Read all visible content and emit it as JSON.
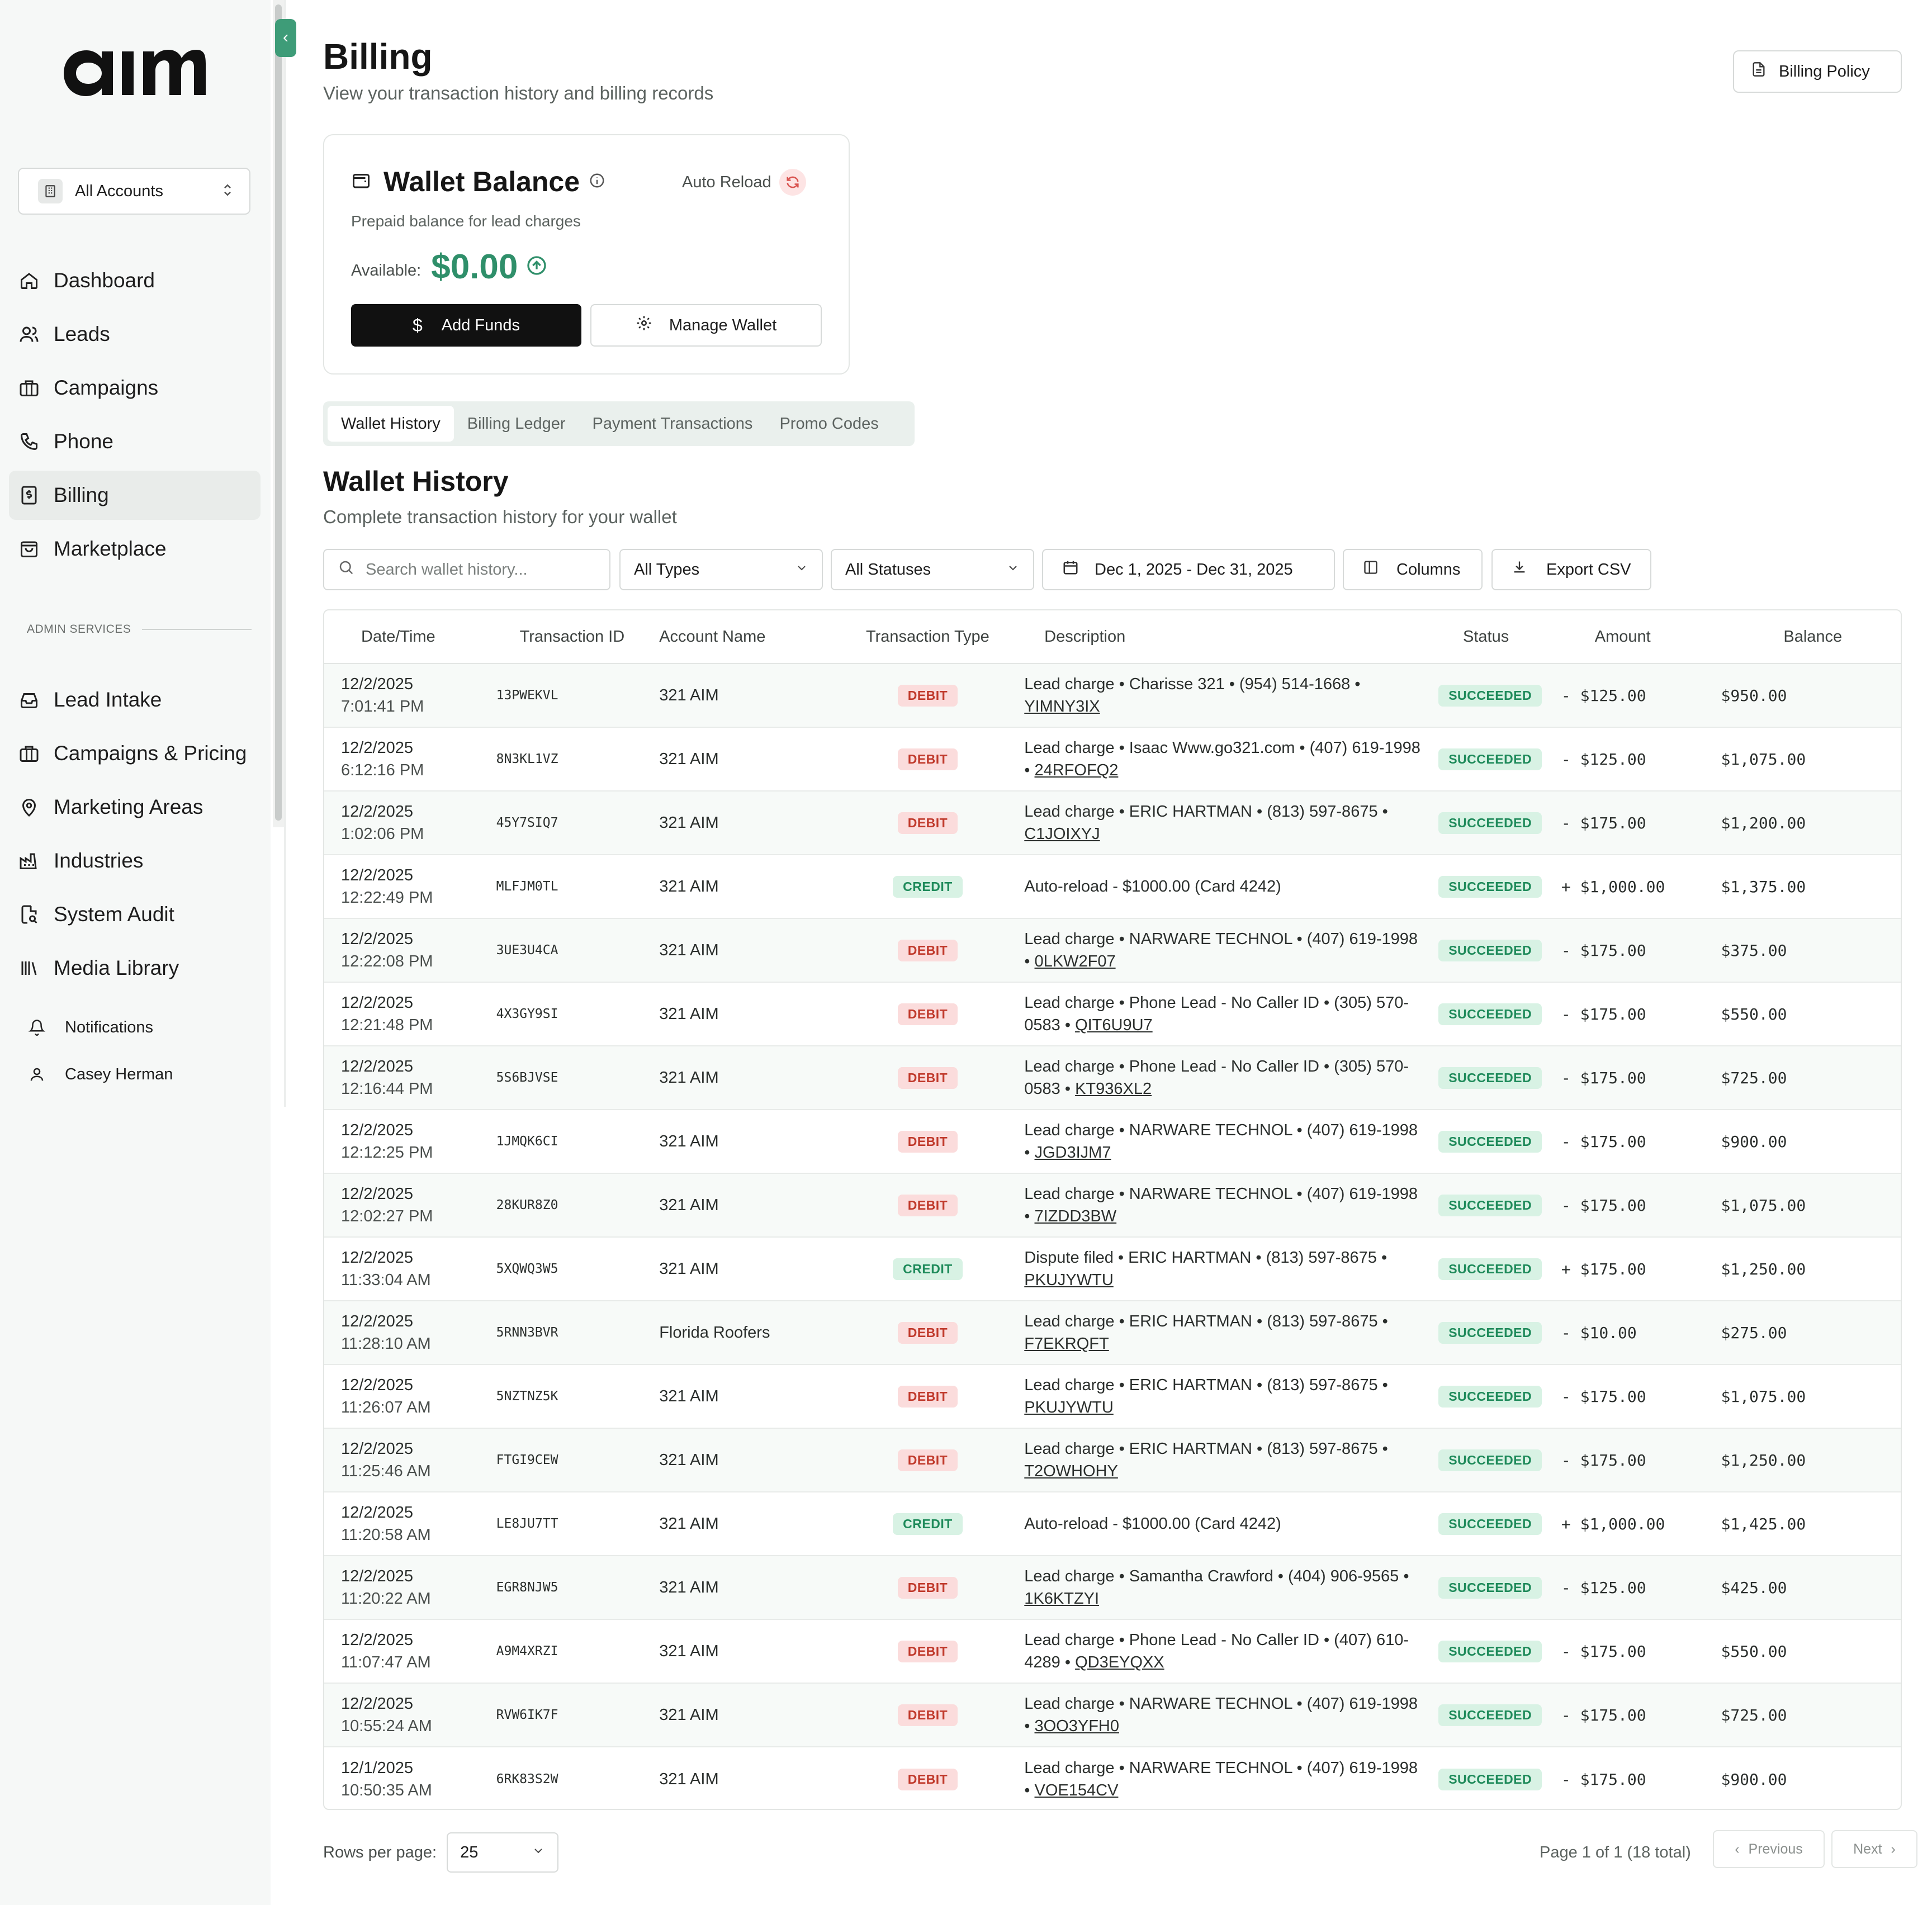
{
  "app": {
    "logo_text": "aim"
  },
  "sidebar": {
    "account_switcher": "All Accounts",
    "nav": [
      {
        "label": "Dashboard",
        "icon": "home-icon",
        "active": false
      },
      {
        "label": "Leads",
        "icon": "users-icon",
        "active": false
      },
      {
        "label": "Campaigns",
        "icon": "briefcase-icon",
        "active": false
      },
      {
        "label": "Phone",
        "icon": "phone-icon",
        "active": false
      },
      {
        "label": "Billing",
        "icon": "receipt-icon",
        "active": true
      },
      {
        "label": "Marketplace",
        "icon": "shopping-bag-icon",
        "active": false
      }
    ],
    "admin_label": "ADMIN SERVICES",
    "admin_nav": [
      {
        "label": "Lead Intake",
        "icon": "inbox-icon"
      },
      {
        "label": "Campaigns & Pricing",
        "icon": "briefcase-icon"
      },
      {
        "label": "Marketing Areas",
        "icon": "map-pin-icon"
      },
      {
        "label": "Industries",
        "icon": "factory-icon"
      },
      {
        "label": "System Audit",
        "icon": "file-search-icon"
      },
      {
        "label": "Media Library",
        "icon": "library-icon"
      }
    ],
    "notifications": "Notifications",
    "user": "Casey Herman"
  },
  "header": {
    "title": "Billing",
    "subtitle": "View your transaction history and billing records",
    "policy_button": "Billing Policy"
  },
  "wallet": {
    "title": "Wallet Balance",
    "auto_reload": "Auto Reload",
    "description": "Prepaid balance for lead charges",
    "available_label": "Available:",
    "available_value": "$0.00",
    "add_funds": "Add Funds",
    "manage_wallet": "Manage Wallet"
  },
  "tabs": [
    "Wallet History",
    "Billing Ledger",
    "Payment Transactions",
    "Promo Codes"
  ],
  "section": {
    "title": "Wallet History",
    "subtitle": "Complete transaction history for your wallet"
  },
  "filters": {
    "search_placeholder": "Search wallet history...",
    "type": "All Types",
    "status": "All Statuses",
    "date_range": "Dec 1, 2025 - Dec 31, 2025",
    "columns": "Columns",
    "export": "Export CSV"
  },
  "table": {
    "headers": [
      "Date/Time",
      "Transaction ID",
      "Account Name",
      "Transaction Type",
      "Description",
      "Status",
      "Amount",
      "Balance"
    ],
    "rows": [
      {
        "date": "12/2/2025",
        "time": "7:01:41 PM",
        "id": "13PWEKVL",
        "account": "321 AIM",
        "type": "DEBIT",
        "desc": "Lead charge • Charisse 321 • (954) 514-1668 • ",
        "ref": "YIMNY3IX",
        "status": "SUCCEEDED",
        "amount": "- $125.00",
        "balance": "$950.00"
      },
      {
        "date": "12/2/2025",
        "time": "6:12:16 PM",
        "id": "8N3KL1VZ",
        "account": "321 AIM",
        "type": "DEBIT",
        "desc": "Lead charge • Isaac Www.go321.com • (407) 619-1998 • ",
        "ref": "24RFOFQ2",
        "status": "SUCCEEDED",
        "amount": "- $125.00",
        "balance": "$1,075.00"
      },
      {
        "date": "12/2/2025",
        "time": "1:02:06 PM",
        "id": "45Y7SIQ7",
        "account": "321 AIM",
        "type": "DEBIT",
        "desc": "Lead charge • ERIC HARTMAN • (813) 597-8675 • ",
        "ref": "C1JOIXYJ",
        "status": "SUCCEEDED",
        "amount": "- $175.00",
        "balance": "$1,200.00"
      },
      {
        "date": "12/2/2025",
        "time": "12:22:49 PM",
        "id": "MLFJM0TL",
        "account": "321 AIM",
        "type": "CREDIT",
        "desc": "Auto-reload - $1000.00 (Card 4242)",
        "ref": "",
        "status": "SUCCEEDED",
        "amount": "+ $1,000.00",
        "balance": "$1,375.00"
      },
      {
        "date": "12/2/2025",
        "time": "12:22:08 PM",
        "id": "3UE3U4CA",
        "account": "321 AIM",
        "type": "DEBIT",
        "desc": "Lead charge • NARWARE TECHNOL • (407) 619-1998 • ",
        "ref": "0LKW2F07",
        "status": "SUCCEEDED",
        "amount": "- $175.00",
        "balance": "$375.00"
      },
      {
        "date": "12/2/2025",
        "time": "12:21:48 PM",
        "id": "4X3GY9SI",
        "account": "321 AIM",
        "type": "DEBIT",
        "desc": "Lead charge • Phone Lead - No Caller ID • (305) 570-0583 • ",
        "ref": "QIT6U9U7",
        "status": "SUCCEEDED",
        "amount": "- $175.00",
        "balance": "$550.00"
      },
      {
        "date": "12/2/2025",
        "time": "12:16:44 PM",
        "id": "5S6BJVSE",
        "account": "321 AIM",
        "type": "DEBIT",
        "desc": "Lead charge • Phone Lead - No Caller ID • (305) 570-0583 • ",
        "ref": "KT936XL2",
        "status": "SUCCEEDED",
        "amount": "- $175.00",
        "balance": "$725.00"
      },
      {
        "date": "12/2/2025",
        "time": "12:12:25 PM",
        "id": "1JMQK6CI",
        "account": "321 AIM",
        "type": "DEBIT",
        "desc": "Lead charge • NARWARE TECHNOL • (407) 619-1998 • ",
        "ref": "JGD3IJM7",
        "status": "SUCCEEDED",
        "amount": "- $175.00",
        "balance": "$900.00"
      },
      {
        "date": "12/2/2025",
        "time": "12:02:27 PM",
        "id": "28KUR8Z0",
        "account": "321 AIM",
        "type": "DEBIT",
        "desc": "Lead charge • NARWARE TECHNOL • (407) 619-1998 • ",
        "ref": "7IZDD3BW",
        "status": "SUCCEEDED",
        "amount": "- $175.00",
        "balance": "$1,075.00"
      },
      {
        "date": "12/2/2025",
        "time": "11:33:04 AM",
        "id": "5XQWQ3W5",
        "account": "321 AIM",
        "type": "CREDIT",
        "desc": "Dispute filed • ERIC HARTMAN • (813) 597-8675 • ",
        "ref": "PKUJYWTU",
        "status": "SUCCEEDED",
        "amount": "+ $175.00",
        "balance": "$1,250.00"
      },
      {
        "date": "12/2/2025",
        "time": "11:28:10 AM",
        "id": "5RNN3BVR",
        "account": "Florida Roofers",
        "type": "DEBIT",
        "desc": "Lead charge • ERIC HARTMAN • (813) 597-8675 • ",
        "ref": "F7EKRQFT",
        "status": "SUCCEEDED",
        "amount": "- $10.00",
        "balance": "$275.00"
      },
      {
        "date": "12/2/2025",
        "time": "11:26:07 AM",
        "id": "5NZTNZ5K",
        "account": "321 AIM",
        "type": "DEBIT",
        "desc": "Lead charge • ERIC HARTMAN • (813) 597-8675 • ",
        "ref": "PKUJYWTU",
        "status": "SUCCEEDED",
        "amount": "- $175.00",
        "balance": "$1,075.00"
      },
      {
        "date": "12/2/2025",
        "time": "11:25:46 AM",
        "id": "FTGI9CEW",
        "account": "321 AIM",
        "type": "DEBIT",
        "desc": "Lead charge • ERIC HARTMAN • (813) 597-8675 • ",
        "ref": "T2OWHOHY",
        "status": "SUCCEEDED",
        "amount": "- $175.00",
        "balance": "$1,250.00"
      },
      {
        "date": "12/2/2025",
        "time": "11:20:58 AM",
        "id": "LE8JU7TT",
        "account": "321 AIM",
        "type": "CREDIT",
        "desc": "Auto-reload - $1000.00 (Card 4242)",
        "ref": "",
        "status": "SUCCEEDED",
        "amount": "+ $1,000.00",
        "balance": "$1,425.00"
      },
      {
        "date": "12/2/2025",
        "time": "11:20:22 AM",
        "id": "EGR8NJW5",
        "account": "321 AIM",
        "type": "DEBIT",
        "desc": "Lead charge • Samantha Crawford • (404) 906-9565 • ",
        "ref": "1K6KTZYI",
        "status": "SUCCEEDED",
        "amount": "- $125.00",
        "balance": "$425.00"
      },
      {
        "date": "12/2/2025",
        "time": "11:07:47 AM",
        "id": "A9M4XRZI",
        "account": "321 AIM",
        "type": "DEBIT",
        "desc": "Lead charge • Phone Lead - No Caller ID • (407) 610-4289 • ",
        "ref": "QD3EYQXX",
        "status": "SUCCEEDED",
        "amount": "- $175.00",
        "balance": "$550.00"
      },
      {
        "date": "12/2/2025",
        "time": "10:55:24 AM",
        "id": "RVW6IK7F",
        "account": "321 AIM",
        "type": "DEBIT",
        "desc": "Lead charge • NARWARE TECHNOL • (407) 619-1998 • ",
        "ref": "3OO3YFH0",
        "status": "SUCCEEDED",
        "amount": "- $175.00",
        "balance": "$725.00"
      },
      {
        "date": "12/1/2025",
        "time": "10:50:35 AM",
        "id": "6RK83S2W",
        "account": "321 AIM",
        "type": "DEBIT",
        "desc": "Lead charge • NARWARE TECHNOL • (407) 619-1998 • ",
        "ref": "VOE154CV",
        "status": "SUCCEEDED",
        "amount": "- $175.00",
        "balance": "$900.00"
      }
    ]
  },
  "pagination": {
    "rows_label": "Rows per page:",
    "rows_value": "25",
    "page_info": "Page 1 of 1 (18 total)",
    "previous": "Previous",
    "next": "Next"
  },
  "colors": {
    "accent": "#3e9c78",
    "debit": "#c0392b",
    "credit": "#1e8a5a",
    "balance_green": "#2f8f6a"
  }
}
